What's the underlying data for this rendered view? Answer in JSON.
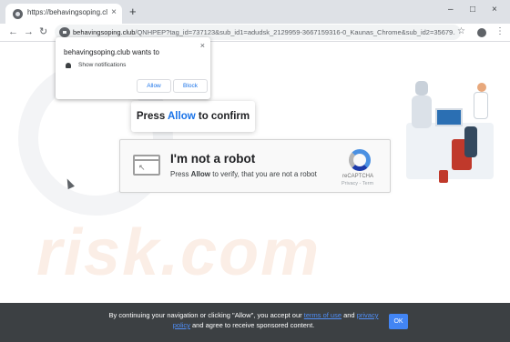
{
  "browser": {
    "tab_title": "https://behavingsoping.club/Q",
    "tab_close": "×",
    "new_tab": "+",
    "window_controls": {
      "minimize": "–",
      "maximize": "□",
      "close": "×"
    },
    "back": "←",
    "forward": "→",
    "reload": "↻",
    "url_domain": "behavingsoping.club",
    "url_path": "/QNHPEP?tag_id=737123&sub_id1=adudsk_2129959-3667159316-0_Kaunas_Chrome&sub_id2=35679...",
    "star": "☆",
    "menu": "⋮"
  },
  "prompt": {
    "title": "behavingsoping.club wants to",
    "close": "×",
    "description": "Show notifications",
    "allow_label": "Allow",
    "block_label": "Block"
  },
  "confirm": {
    "prefix": "Press ",
    "allow": "Allow",
    "suffix": " to confirm"
  },
  "captcha": {
    "title": "I'm not a robot",
    "sub_prefix": "Press ",
    "sub_allow": "Allow",
    "sub_suffix": " to verify, that you are not a robot",
    "brand": "reCAPTCHA",
    "links": "Privacy - Term"
  },
  "watermark": "risk.com",
  "cookie": {
    "text_1": "By continuing your navigation or clicking \"Allow\", you accept our ",
    "terms_link": "terms of use",
    "text_2": " and ",
    "privacy_link": "privacy policy",
    "text_3": " and agree to receive sponsored content.",
    "ok_label": "OK"
  },
  "colors": {
    "accent": "#1a73e8",
    "cookie_bar": "#3c4043",
    "ok_button": "#4285f4"
  }
}
